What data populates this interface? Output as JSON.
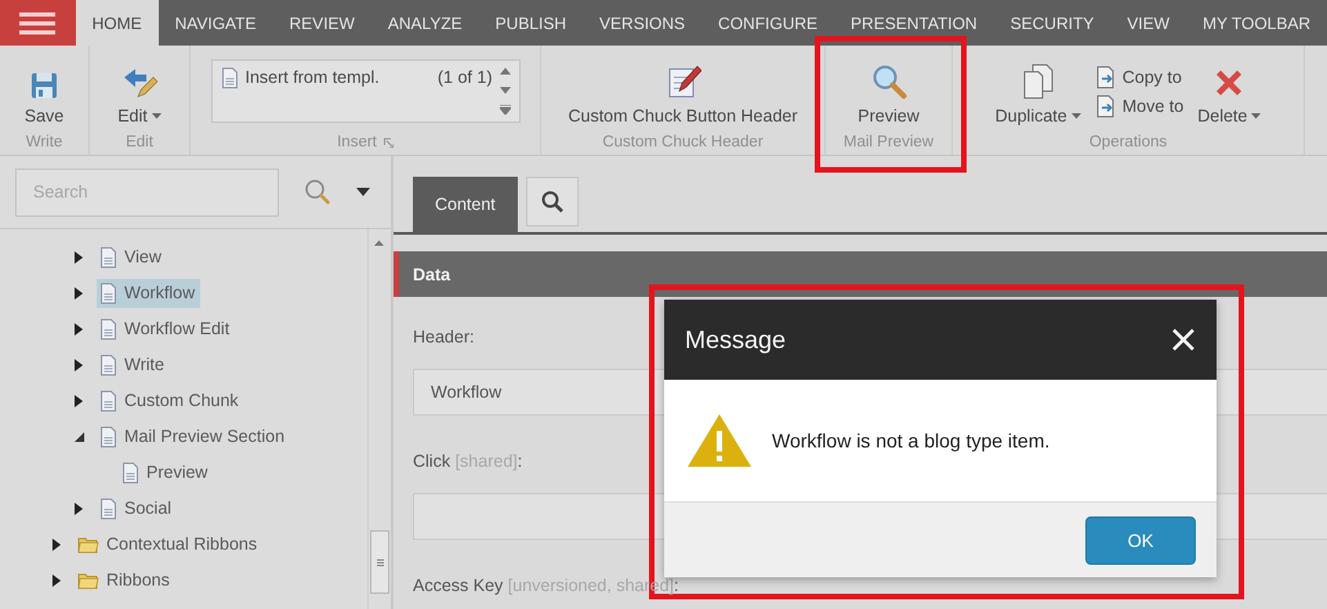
{
  "top_nav": {
    "tabs": [
      {
        "label": "HOME",
        "selected": true
      },
      {
        "label": "NAVIGATE",
        "selected": false
      },
      {
        "label": "REVIEW",
        "selected": false
      },
      {
        "label": "ANALYZE",
        "selected": false
      },
      {
        "label": "PUBLISH",
        "selected": false
      },
      {
        "label": "VERSIONS",
        "selected": false
      },
      {
        "label": "CONFIGURE",
        "selected": false
      },
      {
        "label": "PRESENTATION",
        "selected": false
      },
      {
        "label": "SECURITY",
        "selected": false
      },
      {
        "label": "VIEW",
        "selected": false
      },
      {
        "label": "MY TOOLBAR",
        "selected": false
      }
    ]
  },
  "ribbon": {
    "groups": [
      {
        "label": "Write",
        "launcher": false,
        "items": [
          {
            "kind": "large",
            "label": "Save",
            "dropdown": false
          }
        ]
      },
      {
        "label": "Edit",
        "launcher": false,
        "items": [
          {
            "kind": "large",
            "label": "Edit",
            "dropdown": true
          }
        ]
      },
      {
        "label": "Insert",
        "launcher": true,
        "items": [
          {
            "kind": "gallery",
            "label": "Insert from templ.",
            "count": "(1 of 1)"
          }
        ]
      },
      {
        "label": "Custom Chuck Header",
        "launcher": false,
        "items": [
          {
            "kind": "large",
            "label": "Custom Chuck Button Header",
            "dropdown": false
          }
        ]
      },
      {
        "label": "Mail Preview",
        "launcher": false,
        "items": [
          {
            "kind": "large",
            "label": "Preview",
            "dropdown": false
          }
        ]
      },
      {
        "label": "Operations",
        "launcher": false,
        "items": [
          {
            "kind": "large",
            "label": "Duplicate",
            "dropdown": true
          },
          {
            "kind": "small",
            "label": "Copy to"
          },
          {
            "kind": "small",
            "label": "Move to"
          },
          {
            "kind": "large",
            "label": "Delete",
            "dropdown": true
          }
        ]
      }
    ]
  },
  "sidebar": {
    "search": {
      "placeholder": "Search"
    },
    "tree": [
      {
        "children": [
          {
            "label": "View",
            "kind": "document",
            "expanded": false,
            "selected": false
          },
          {
            "label": "Workflow",
            "kind": "document",
            "expanded": false,
            "selected": true
          },
          {
            "label": "Workflow Edit",
            "kind": "document",
            "expanded": false,
            "selected": false
          },
          {
            "label": "Write",
            "kind": "document",
            "expanded": false,
            "selected": false
          },
          {
            "label": "Custom Chunk",
            "kind": "document",
            "expanded": false,
            "selected": false
          },
          {
            "label": "Mail Preview Section",
            "kind": "document",
            "expanded": true,
            "selected": false,
            "children": [
              {
                "label": "Preview",
                "kind": "document",
                "selected": false
              }
            ]
          },
          {
            "label": "Social",
            "kind": "document",
            "expanded": false,
            "selected": false
          }
        ]
      },
      {
        "label": "Contextual Ribbons",
        "kind": "folder",
        "expanded": false,
        "selected": false
      },
      {
        "label": "Ribbons",
        "kind": "folder",
        "expanded": false,
        "selected": false
      }
    ]
  },
  "content": {
    "tabs": [
      {
        "kind": "text",
        "label": "Content",
        "selected": true
      },
      {
        "kind": "search",
        "selected": false
      }
    ],
    "section": {
      "title": "Data"
    },
    "fields": [
      {
        "kind": "text",
        "label": "Header",
        "end": ":",
        "value": "Workflow"
      },
      {
        "kind": "text",
        "label": "Click",
        "note": "[shared]",
        "end": ":"
      },
      {
        "kind": "label",
        "label": "Access Key",
        "note": "[unversioned, shared]",
        "end": ":"
      }
    ]
  },
  "dialog": {
    "title": "Message",
    "message": "Workflow is not a blog type item.",
    "buttons": [
      "OK"
    ]
  }
}
